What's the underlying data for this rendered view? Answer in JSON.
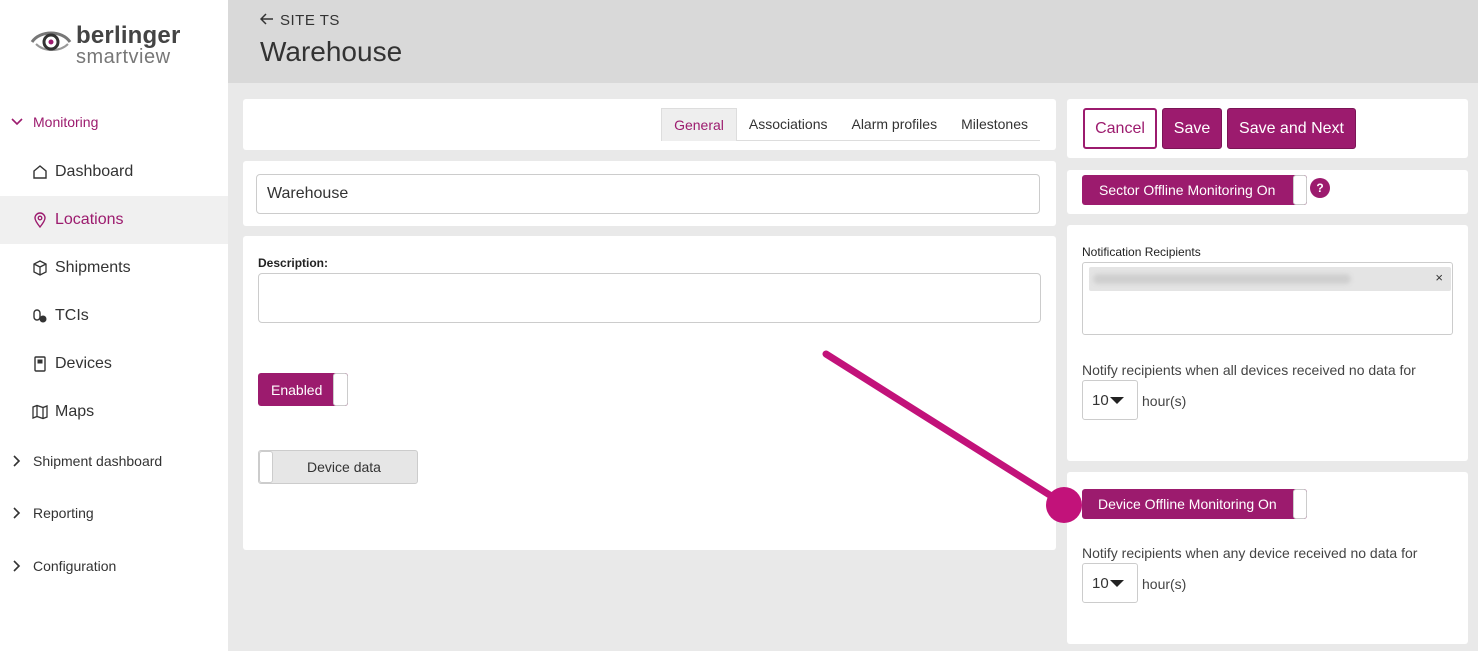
{
  "brand": {
    "name_top": "berlinger",
    "name_bottom": "smartview"
  },
  "sidebar": {
    "monitoring_label": "Monitoring",
    "items": [
      {
        "label": "Dashboard",
        "icon": "home-icon"
      },
      {
        "label": "Locations",
        "icon": "location-pin-icon"
      },
      {
        "label": "Shipments",
        "icon": "box-icon"
      },
      {
        "label": "TCIs",
        "icon": "thermometer-icon"
      },
      {
        "label": "Devices",
        "icon": "device-icon"
      },
      {
        "label": "Maps",
        "icon": "map-icon"
      }
    ],
    "groups": [
      {
        "label": "Shipment dashboard"
      },
      {
        "label": "Reporting"
      },
      {
        "label": "Configuration"
      }
    ]
  },
  "header": {
    "back_label": "SITE TS",
    "title": "Warehouse"
  },
  "tabs": [
    {
      "label": "General",
      "active": true
    },
    {
      "label": "Associations",
      "active": false
    },
    {
      "label": "Alarm profiles",
      "active": false
    },
    {
      "label": "Milestones",
      "active": false
    }
  ],
  "form": {
    "name_value": "Warehouse",
    "description_label": "Description:",
    "description_value": "",
    "enabled_label": "Enabled",
    "device_data_label": "Device data"
  },
  "actions": {
    "cancel": "Cancel",
    "save": "Save",
    "save_next": "Save and Next"
  },
  "sector": {
    "toggle_label": "Sector Offline Monitoring On",
    "help_label": "?",
    "recipients_label": "Notification Recipients",
    "recipient_remove": "×",
    "notify_text": "Notify recipients when all devices received no data for",
    "hours_value": "10",
    "unit": "hour(s)"
  },
  "device": {
    "toggle_label": "Device Offline Monitoring On",
    "notify_text": "Notify recipients when any device received no data for",
    "hours_value": "10",
    "unit": "hour(s)"
  },
  "colors": {
    "accent": "#9c1b6e",
    "annotation": "#c2127a"
  }
}
